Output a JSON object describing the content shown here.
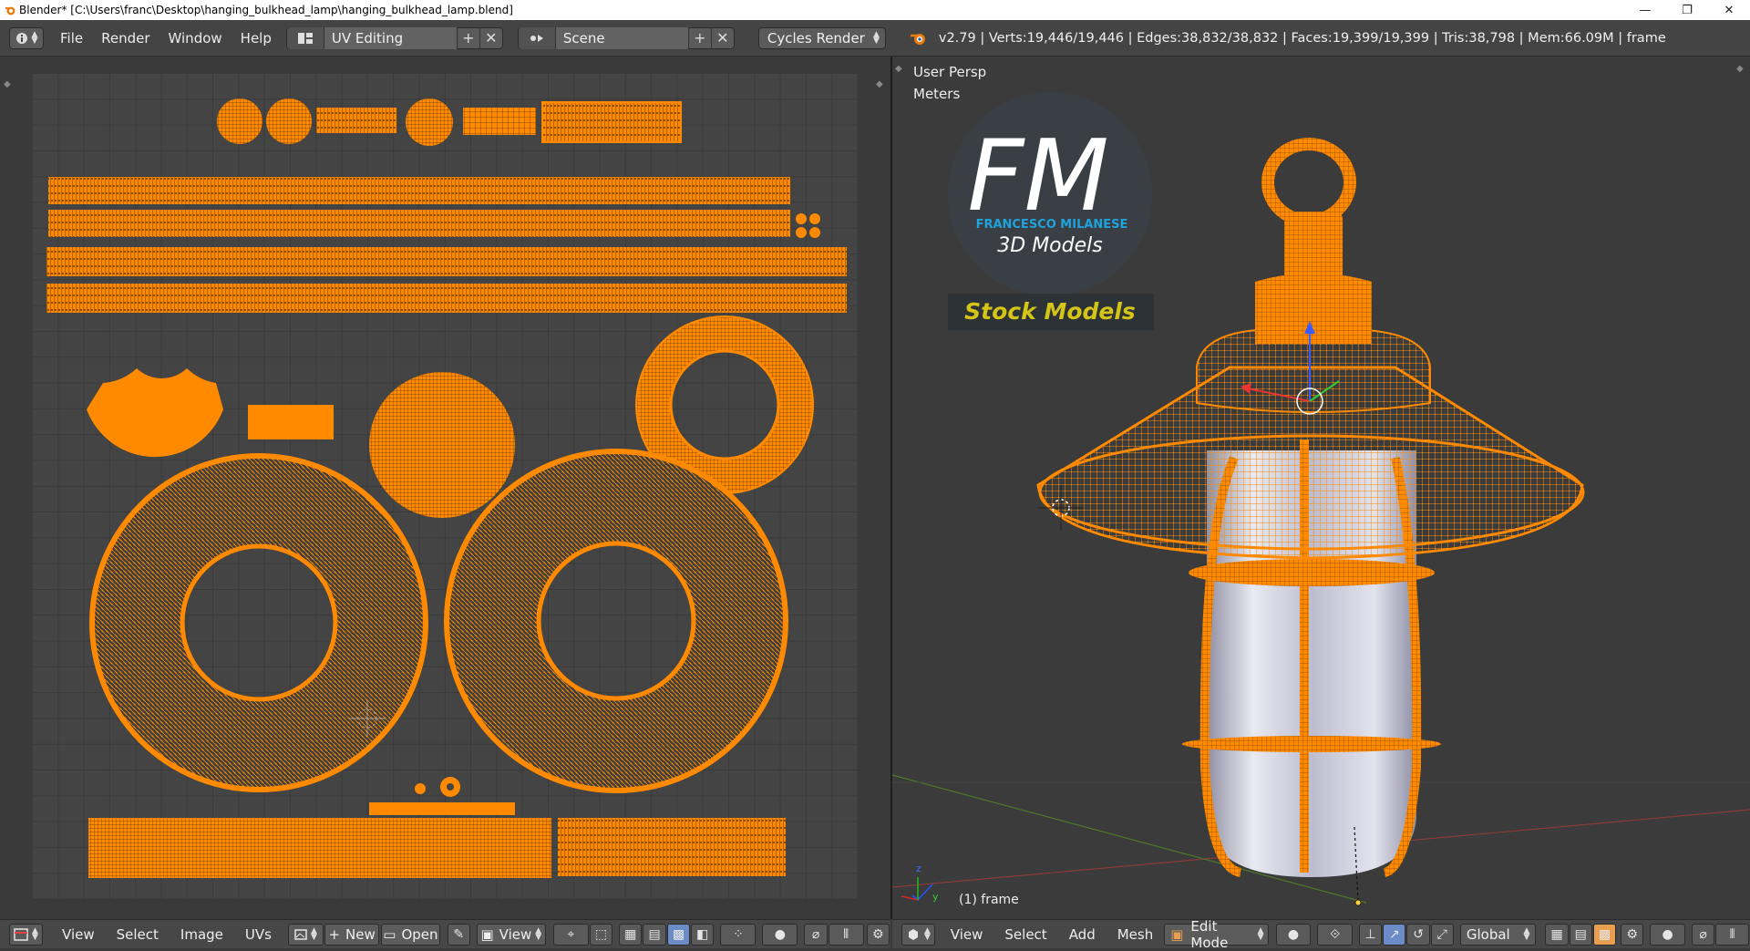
{
  "window": {
    "title": "Blender* [C:\\Users\\franc\\Desktop\\hanging_bulkhead_lamp\\hanging_bulkhead_lamp.blend]",
    "minimize": "—",
    "restore": "❐",
    "close": "✕"
  },
  "info_header": {
    "menus": [
      "File",
      "Render",
      "Window",
      "Help"
    ],
    "screen_layout": "UV Editing",
    "scene": "Scene",
    "render_engine": "Cycles Render",
    "stats": "v2.79 | Verts:19,446/19,446 | Edges:38,832/38,832 | Faces:19,399/19,399 | Tris:38,798 | Mem:66.09M | frame"
  },
  "viewport": {
    "view_name": "User Persp",
    "units": "Meters",
    "object_label": "(1) frame",
    "logo": {
      "letters": "FM",
      "author": "FRANCESCO MILANESE",
      "subtitle": "3D Models",
      "banner": "Stock Models"
    }
  },
  "uv_header": {
    "menus": [
      "View",
      "Select",
      "Image",
      "UVs"
    ],
    "new_label": "New",
    "open_label": "Open",
    "view_label": "View"
  },
  "view3d_header": {
    "menus": [
      "View",
      "Select",
      "Add",
      "Mesh"
    ],
    "mode": "Edit Mode",
    "orientation": "Global"
  },
  "colors": {
    "accent_orange": "#ff8a00",
    "uv_grid": "#444444",
    "background": "#393939",
    "logo_blue": "#1fa3dc",
    "banner_yellow": "#d4c417"
  },
  "icons": [
    "info-icon",
    "blender-logo-icon",
    "uv-editor-icon",
    "3d-view-icon",
    "add-icon",
    "close-icon",
    "image-icon",
    "pin-icon",
    "pivot-icon",
    "snap-icon",
    "proportional-icon",
    "manipulator-icon",
    "global-icon",
    "layers-icon"
  ]
}
